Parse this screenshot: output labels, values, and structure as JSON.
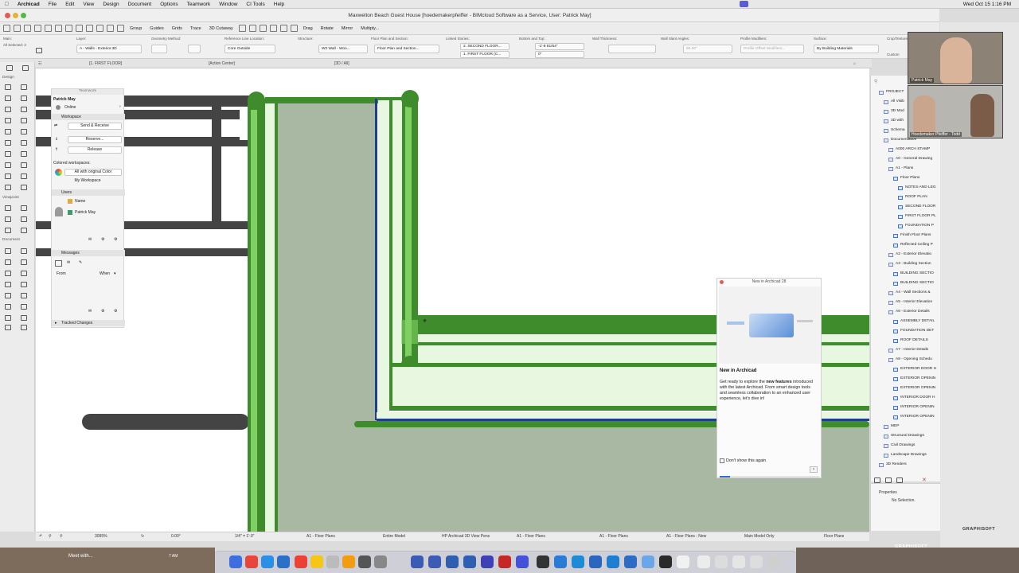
{
  "menubar": {
    "app": "Archicad",
    "items": [
      "File",
      "Edit",
      "View",
      "Design",
      "Document",
      "Options",
      "Teamwork",
      "Window",
      "CI Tools",
      "Help"
    ],
    "clock": "Wed Oct 15  1:16 PM"
  },
  "window": {
    "title": "Maxwelton Beach Guest House [hoedemakerpfeiffer - BIMcloud Software as a Service, User: Patrick May]"
  },
  "toolbar": {
    "group": "Group",
    "guides": "Guides",
    "grids": "Grids",
    "trace": "Trace",
    "cutaway": "3D Cutaway",
    "drag": "Drag",
    "rotate": "Rotate",
    "mirror": "Mirror",
    "multiply": "Multiply..."
  },
  "infobox": {
    "main_label": "Main:",
    "selected": "All Selected: 3",
    "layer_label": "Layer:",
    "layer_value": "A - Walls - Exterior.3D",
    "geometry_label": "Geometry Method:",
    "refline_label": "Reference Line Location:",
    "refline_value": "Core Outside",
    "structure_label": "Structure:",
    "structure_value": "W2 Wall - Woo...",
    "floorplan_label": "Floor Plan and Section:",
    "floorplan_value": "Floor Plan and Section...",
    "linked_label": "Linked Stories:",
    "linked_top": "2. SECOND FLOOR...",
    "linked_bottom": "1. FIRST FLOOR (C...",
    "bottomtop_label": "Bottom and Top:",
    "top_value": "-1'-8 81/64\"",
    "bottom_value": "0\"",
    "thickness_label": "Wall Thickness:",
    "slant_label": "Wall Slant Angles:",
    "slant_value": "90.00°",
    "profile_label": "Profile Modifiers:",
    "profile_value": "Profile Offset Modifiers...",
    "surface_label": "Surface:",
    "surface_value": "By Building Materials",
    "crop_label": "Crop/Tenture:",
    "crop_value": "Custom"
  },
  "tabs": [
    "[1. FIRST FLOOR]",
    "[Action Center]",
    "[3D / All]"
  ],
  "leftbar": {
    "design": "Design",
    "viewpoint": "Viewpoint",
    "document": "Document"
  },
  "teamwork": {
    "title": "Teamwork",
    "user": "Patrick May",
    "status": "Online",
    "workspace": "Workspace",
    "send_receive": "Send & Receive",
    "reserve": "Reserve...",
    "release": "Release",
    "colored_label": "Colored workspaces:",
    "colored_value": "All with original Color",
    "my_workspace": "My Workspace",
    "users": "Users",
    "name_col": "Name",
    "user_name": "Patrick May",
    "messages": "Messages",
    "from_col": "From",
    "when_col": "When",
    "tracked": "Tracked Changes"
  },
  "popup": {
    "header": "New in Archicad 28",
    "title": "New in Archicad",
    "body_pre": "Get ready to explore the ",
    "body_bold": "new features",
    "body_post": " introduced with the latest Archicad. From smart design tools and seamless collaboration to an enhanced user experience, let's dive in!",
    "checkbox": "Don't show this again",
    "progress": 0.1
  },
  "navigator": {
    "items": [
      {
        "label": "PROJECT",
        "indent": 0
      },
      {
        "label": "All Visib",
        "indent": 1
      },
      {
        "label": "3D Mod",
        "indent": 1
      },
      {
        "label": "3D with",
        "indent": 1
      },
      {
        "label": "Schema",
        "indent": 1
      },
      {
        "label": "Documentation",
        "indent": 1
      },
      {
        "label": "A000 ARCH STAMP",
        "indent": 2
      },
      {
        "label": "A0 - General Drawing",
        "indent": 2
      },
      {
        "label": "A1 - Plans",
        "indent": 2
      },
      {
        "label": "Floor Plans",
        "indent": 3
      },
      {
        "label": "NOTES AND LEG",
        "indent": 4
      },
      {
        "label": "ROOF PLAN",
        "indent": 4
      },
      {
        "label": "SECOND FLOOR",
        "indent": 4
      },
      {
        "label": "FIRST FLOOR PL",
        "indent": 4
      },
      {
        "label": "FOUNDATION P",
        "indent": 4
      },
      {
        "label": "Finish Floor Plans",
        "indent": 3
      },
      {
        "label": "Reflected Ceiling P",
        "indent": 3
      },
      {
        "label": "A2 - Exterior Elevatio",
        "indent": 2
      },
      {
        "label": "A3 - Building Section",
        "indent": 2
      },
      {
        "label": "BUILDING SECTIO",
        "indent": 3
      },
      {
        "label": "BUILDING SECTIO",
        "indent": 3
      },
      {
        "label": "A4 - Wall Sections &",
        "indent": 2
      },
      {
        "label": "A5 - Interior Elevation",
        "indent": 2
      },
      {
        "label": "A6 - Exterior Details",
        "indent": 2
      },
      {
        "label": "ASSEMBLY DETAIL",
        "indent": 3
      },
      {
        "label": "FOUNDATION DET",
        "indent": 3
      },
      {
        "label": "ROOF DETAILS",
        "indent": 3
      },
      {
        "label": "A7 - Interior Details",
        "indent": 2
      },
      {
        "label": "A8 - Opening Schedu",
        "indent": 2
      },
      {
        "label": "EXTERIOR DOOR H",
        "indent": 3
      },
      {
        "label": "EXTERIOR OPENIN",
        "indent": 3
      },
      {
        "label": "EXTERIOR OPENIN",
        "indent": 3
      },
      {
        "label": "INTERIOR DOOR H",
        "indent": 3
      },
      {
        "label": "INTERIOR OPENIN",
        "indent": 3
      },
      {
        "label": "INTERIOR OPENIN",
        "indent": 3
      },
      {
        "label": "MEP",
        "indent": 1
      },
      {
        "label": "Structural Drawings",
        "indent": 1
      },
      {
        "label": "Civil Drawings",
        "indent": 1
      },
      {
        "label": "Landscape Drawings",
        "indent": 1
      },
      {
        "label": "3D Renders",
        "indent": 0
      }
    ]
  },
  "properties": {
    "title": "Properties",
    "value": "No Selection."
  },
  "statusbar": {
    "zoom": "3095%",
    "angle": "0.00°",
    "scale": "1/4\" = 1'-0\"",
    "layers": "A1 - Floor Plans",
    "model": "Entire Model",
    "pens": "HP Archicad 3D View Pens",
    "plan1": "A1 - Floor Plans",
    "plan2": "A1 - Floor Plans",
    "plan3": "A1 - Floor Plans - New",
    "model_only": "Main Model Only",
    "floor_plans": "Floor Plans"
  },
  "video": {
    "caller1": "Patrick May",
    "caller2": "Hoedemaker Pfeiffer - Todd"
  },
  "desktop": {
    "meet": "Meet with...",
    "time": "7 AM",
    "graphisoft": "GRAPHISOFT"
  },
  "colors": {
    "wall_dark": "#3e8c2b",
    "wall_light": "#7fd062",
    "wall_pale": "#e7f7e0",
    "fill": "#a8b8a2",
    "poche": "#444444",
    "blue_line": "#1f3e8c"
  }
}
